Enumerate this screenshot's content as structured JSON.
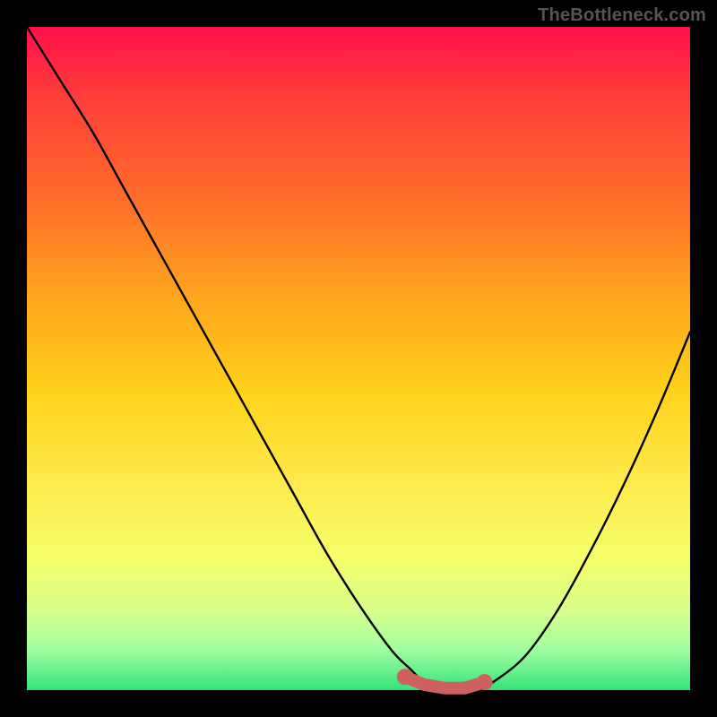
{
  "watermark": "TheBottleneck.com",
  "colors": {
    "background": "#000000",
    "gradient_top": "#ff104a",
    "gradient_bottom": "#35e27a",
    "curve": "#000000",
    "marker": "#cf6060"
  },
  "chart_data": {
    "type": "line",
    "title": "",
    "xlabel": "",
    "ylabel": "",
    "xlim": [
      0,
      100
    ],
    "ylim": [
      0,
      100
    ],
    "x": [
      0,
      5,
      10,
      15,
      20,
      25,
      30,
      35,
      40,
      45,
      50,
      55,
      58,
      60,
      62,
      65,
      68,
      70,
      75,
      80,
      85,
      90,
      95,
      100
    ],
    "values": [
      100,
      92,
      84,
      75,
      66,
      57,
      48,
      39,
      30,
      21,
      13,
      6,
      3,
      1,
      0,
      0,
      0,
      1,
      5,
      12,
      21,
      31,
      42,
      54
    ],
    "markers": {
      "x": [
        57,
        60,
        63,
        66,
        69
      ],
      "y": [
        2,
        0.8,
        0.3,
        0.3,
        1.2
      ]
    }
  }
}
